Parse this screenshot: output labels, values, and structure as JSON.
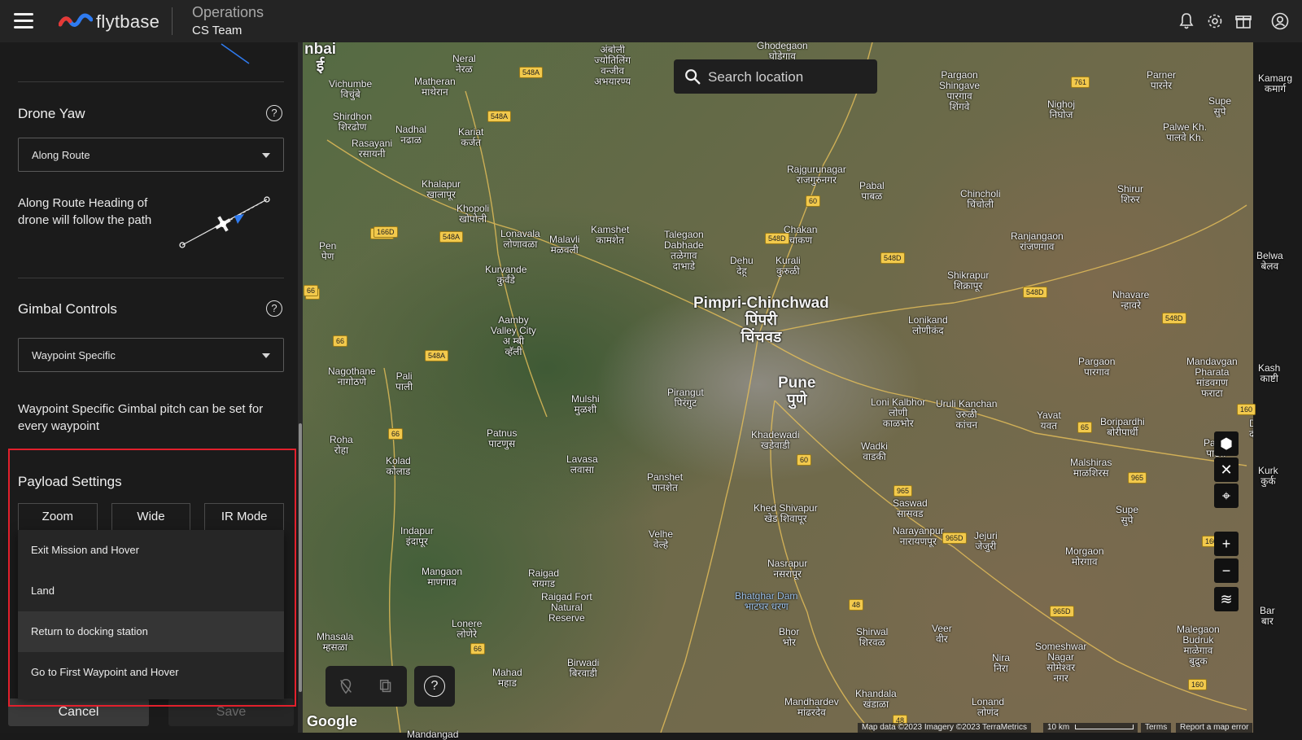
{
  "topbar": {
    "logo_text": "flytbase",
    "title": "Operations",
    "subtitle": "CS Team",
    "icons": [
      "bell-icon",
      "gear-icon",
      "gift-icon",
      "account-icon"
    ]
  },
  "panel": {
    "drone_yaw": {
      "title": "Drone Yaw",
      "help": "?",
      "selected": "Along Route",
      "description": "Along Route Heading of drone will follow the path"
    },
    "gimbal": {
      "title": "Gimbal Controls",
      "help": "?",
      "selected": "Waypoint Specific",
      "description": "Waypoint Specific Gimbal pitch can be set for every waypoint"
    },
    "payload": {
      "title": "Payload Settings",
      "tabs": [
        "Zoom",
        "Wide",
        "IR Mode"
      ]
    },
    "dropdown_menu": {
      "items": [
        {
          "label": "Exit Mission and Hover",
          "highlighted": false
        },
        {
          "label": "Land",
          "highlighted": false
        },
        {
          "label": "Return to docking station",
          "highlighted": true
        },
        {
          "label": "Go to First Waypoint and Hover",
          "highlighted": false
        }
      ]
    },
    "footer": {
      "cancel": "Cancel",
      "save": "Save"
    }
  },
  "map": {
    "search_placeholder": "Search location",
    "places": [
      {
        "name": "nbai\nई",
        "big": true
      },
      {
        "name": "Ghodegaon\nघोडेगाव"
      },
      {
        "name": "Neral\nनेरळ"
      },
      {
        "name": "Matheran\nमाथेरान"
      },
      {
        "name": "Vichumbe\nविचुंबे"
      },
      {
        "name": "Shirdhon\nशिरढोण"
      },
      {
        "name": "Nadhal\nनढाळ"
      },
      {
        "name": "Kariat\nकर्जत"
      },
      {
        "name": "Rasayani\nरसायनी"
      },
      {
        "name": "Khalapur\nखालापूर"
      },
      {
        "name": "Khopoli\nखोपोली"
      },
      {
        "name": "Pen\nपेण"
      },
      {
        "name": "Lonavala\nलोणावळा"
      },
      {
        "name": "Malavli\nमळवली"
      },
      {
        "name": "Kamshet\nकामशेत"
      },
      {
        "name": "Talegaon\nDabhade\nतळेगाव\nदाभाडे"
      },
      {
        "name": "Dehu\nदेहू"
      },
      {
        "name": "Kurali\nकुरुळी"
      },
      {
        "name": "Chakan\nचाकण"
      },
      {
        "name": "Rajgurunagar\nराजगुरुनगर"
      },
      {
        "name": "Pabal\nपाबळ"
      },
      {
        "name": "Chincholi\nचिंचोली"
      },
      {
        "name": "Shirur\nशिरुर"
      },
      {
        "name": "Pargaon\nShingave\nपारगाव\nशिंगवे"
      },
      {
        "name": "Nighoj\nनिघोज"
      },
      {
        "name": "Parner\nपारनेर"
      },
      {
        "name": "Palwe Kh.\nपालवे Kh."
      },
      {
        "name": "Supe\nसुपे"
      },
      {
        "name": "Kamarg\nकमार्ग"
      },
      {
        "name": "Kurvande\nकुर्वंडे"
      },
      {
        "name": "Pimpri-Chinchwad\nपिंपरी\nचिंचवड",
        "big": true
      },
      {
        "name": "Ranjangaon\nरांजणगाव"
      },
      {
        "name": "Shikrapur\nशिक्रापूर"
      },
      {
        "name": "Lonikand\nलोणीकंद"
      },
      {
        "name": "Nhavare\nन्हावरे"
      },
      {
        "name": "Belwa\nबेलव"
      },
      {
        "name": "Aamby\nValley City\nअ म्बी\nव्हॅली"
      },
      {
        "name": "Nagothane\nनागोठणे"
      },
      {
        "name": "Pali\nपाली"
      },
      {
        "name": "Pune\nपुणे",
        "big": true
      },
      {
        "name": "Pirangut\nपिरंगुट"
      },
      {
        "name": "Mulshi\nमुळशी"
      },
      {
        "name": "Loni Kalbhor\nलोणी\nकाळभोर"
      },
      {
        "name": "Uruli Kanchan\nउरुळी\nकांचन"
      },
      {
        "name": "Pargaon\nपारगाव"
      },
      {
        "name": "Mandavgan\nPharata\nमांडवगण\nफराटा"
      },
      {
        "name": "Kash\nकाष्टी"
      },
      {
        "name": "Yavat\nयवत"
      },
      {
        "name": "Boripardhi\nबोरीपार्धी"
      },
      {
        "name": "Daur\nदौंड"
      },
      {
        "name": "Patas\nपाटस"
      },
      {
        "name": "Khadewadi\nखडेवाडी"
      },
      {
        "name": "Wadki\nवाडकी"
      },
      {
        "name": "Roha\nरोहा"
      },
      {
        "name": "Patnus\nपाटणुस"
      },
      {
        "name": "Kolad\nकोलाड"
      },
      {
        "name": "Lavasa\nलवासा"
      },
      {
        "name": "Panshet\nपानशेत"
      },
      {
        "name": "Malshiras\nमाळशिरस"
      },
      {
        "name": "Kurk\nकुर्क"
      },
      {
        "name": "Saswad\nसासवड"
      },
      {
        "name": "Khed Shivapur\nखेड शिवापूर"
      },
      {
        "name": "Supe\nसुपे"
      },
      {
        "name": "Indapur\nइंदापूर"
      },
      {
        "name": "Velhe\nवेल्हे"
      },
      {
        "name": "Narayanpur\nनारायणपूर"
      },
      {
        "name": "Jejuri\nजेजुरी"
      },
      {
        "name": "Morgaon\nमोरगाव"
      },
      {
        "name": "Mangaon\nमाणगाव"
      },
      {
        "name": "Raigad\nरायगड"
      },
      {
        "name": "Raigad Fort\nNatural\nReserve",
        "big": false
      },
      {
        "name": "Nasrapur\nनसरापूर"
      },
      {
        "name": "Bhatghar Dam\nभाटघर धरण",
        "blue": true
      },
      {
        "name": "Lonere\nलोणेरे"
      },
      {
        "name": "Mhasala\nम्हसळा"
      },
      {
        "name": "Bhor\nभोर"
      },
      {
        "name": "Shirwal\nशिरवळ"
      },
      {
        "name": "Veer\nवीर"
      },
      {
        "name": "Someshwar\nNagar\nसोमेश्वर\nनगर"
      },
      {
        "name": "Nira\nनिरा"
      },
      {
        "name": "Malegaon\nBudruk\nमाळेगाव\nबुद्रुक"
      },
      {
        "name": "Bar\nबार"
      },
      {
        "name": "Mahad\nमहाड"
      },
      {
        "name": "Birwadi\nबिरवाडी"
      },
      {
        "name": "Mandhardev\nमांढरदेव"
      },
      {
        "name": "Khandala\nखंडाळा"
      },
      {
        "name": "Lonand\nलोणंद"
      },
      {
        "name": "Mandangad",
        "big": false
      },
      {
        "name": "अंबोली\nज्योतिलिंग\nवन्जीव\nअभयारण्य"
      }
    ],
    "road_shields": [
      "548A",
      "548A",
      "548A",
      "548A",
      "548A",
      "166D",
      "548D",
      "548D",
      "548D",
      "548D",
      "60",
      "60",
      "761",
      "66",
      "66",
      "66",
      "66",
      "66",
      "65",
      "160",
      "160",
      "160",
      "965",
      "965",
      "965D",
      "965D",
      "48",
      "48"
    ],
    "attribution": {
      "map_data": "Map data ©2023 Imagery ©2023 TerraMetrics",
      "scale": "10 km",
      "terms": "Terms",
      "report": "Report a map error",
      "google": "Google"
    },
    "controls": {
      "zoom_in": "+",
      "zoom_out": "−"
    },
    "tools": {
      "help": "?"
    }
  }
}
